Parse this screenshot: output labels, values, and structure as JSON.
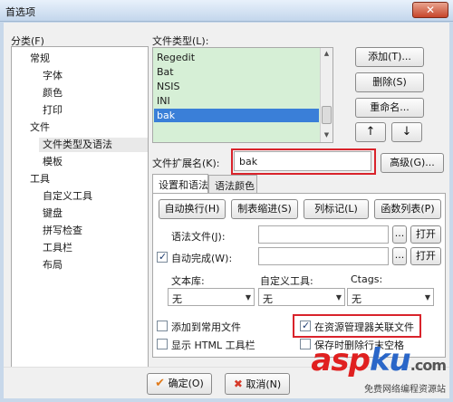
{
  "window": {
    "title": "首选项",
    "close_glyph": "✕"
  },
  "category": {
    "label": "分类(F)",
    "items": [
      {
        "label": "常规",
        "level": 0
      },
      {
        "label": "字体",
        "level": 1
      },
      {
        "label": "颜色",
        "level": 1
      },
      {
        "label": "打印",
        "level": 1
      },
      {
        "label": "文件",
        "level": 0
      },
      {
        "label": "文件类型及语法",
        "level": 1,
        "selected": true
      },
      {
        "label": "模板",
        "level": 1
      },
      {
        "label": "工具",
        "level": 0
      },
      {
        "label": "自定义工具",
        "level": 1
      },
      {
        "label": "键盘",
        "level": 1
      },
      {
        "label": "拼写检查",
        "level": 1
      },
      {
        "label": "工具栏",
        "level": 1
      },
      {
        "label": "布局",
        "level": 1
      }
    ]
  },
  "filetypes": {
    "label": "文件类型(L):",
    "items": [
      "Regedit",
      "Bat",
      "NSIS",
      "INI",
      "bak"
    ],
    "selected": "bak",
    "add_button": "添加(T)...",
    "delete_button": "删除(S)",
    "rename_button": "重命名...",
    "up_glyph": "↑",
    "down_glyph": "↓"
  },
  "extension": {
    "label": "文件扩展名(K):",
    "value": "bak",
    "advanced_button": "高级(G)..."
  },
  "tabs": [
    {
      "label": "设置和语法",
      "active": true
    },
    {
      "label": "语法颜色",
      "active": false
    }
  ],
  "panel": {
    "wrap_button": "自动换行(H)",
    "tab_button": "制表缩进(S)",
    "column_button": "列标记(L)",
    "function_button": "函数列表(P)",
    "syntax_file_label": "语法文件(J):",
    "autocomplete_label": "自动完成(W):",
    "autocomplete_checked": true,
    "browse_glyph": "...",
    "open_button": "打开",
    "textlib_label": "文本库:",
    "customtool_label": "自定义工具:",
    "ctags_label": "Ctags:",
    "combo_value": "无",
    "add_common_label": "添加到常用文件",
    "assoc_label": "在资源管理器关联文件",
    "show_html_label": "显示 HTML 工具栏",
    "trim_label": "保存时删除行末空格",
    "add_common_checked": false,
    "assoc_checked": true,
    "show_html_checked": false,
    "trim_checked": false
  },
  "footer": {
    "ok_button": "确定(O)",
    "cancel_button": "取消(N)",
    "ok_glyph": "✔",
    "cancel_glyph": "✖"
  },
  "watermark": {
    "logo_a": "asp",
    "logo_b": "ku",
    "logo_c": ".com",
    "tagline": "免费网络编程资源站"
  },
  "colors": {
    "accent": "#3a7fd8",
    "list_bg": "#d6efd6",
    "highlight_red": "#d9232b"
  }
}
